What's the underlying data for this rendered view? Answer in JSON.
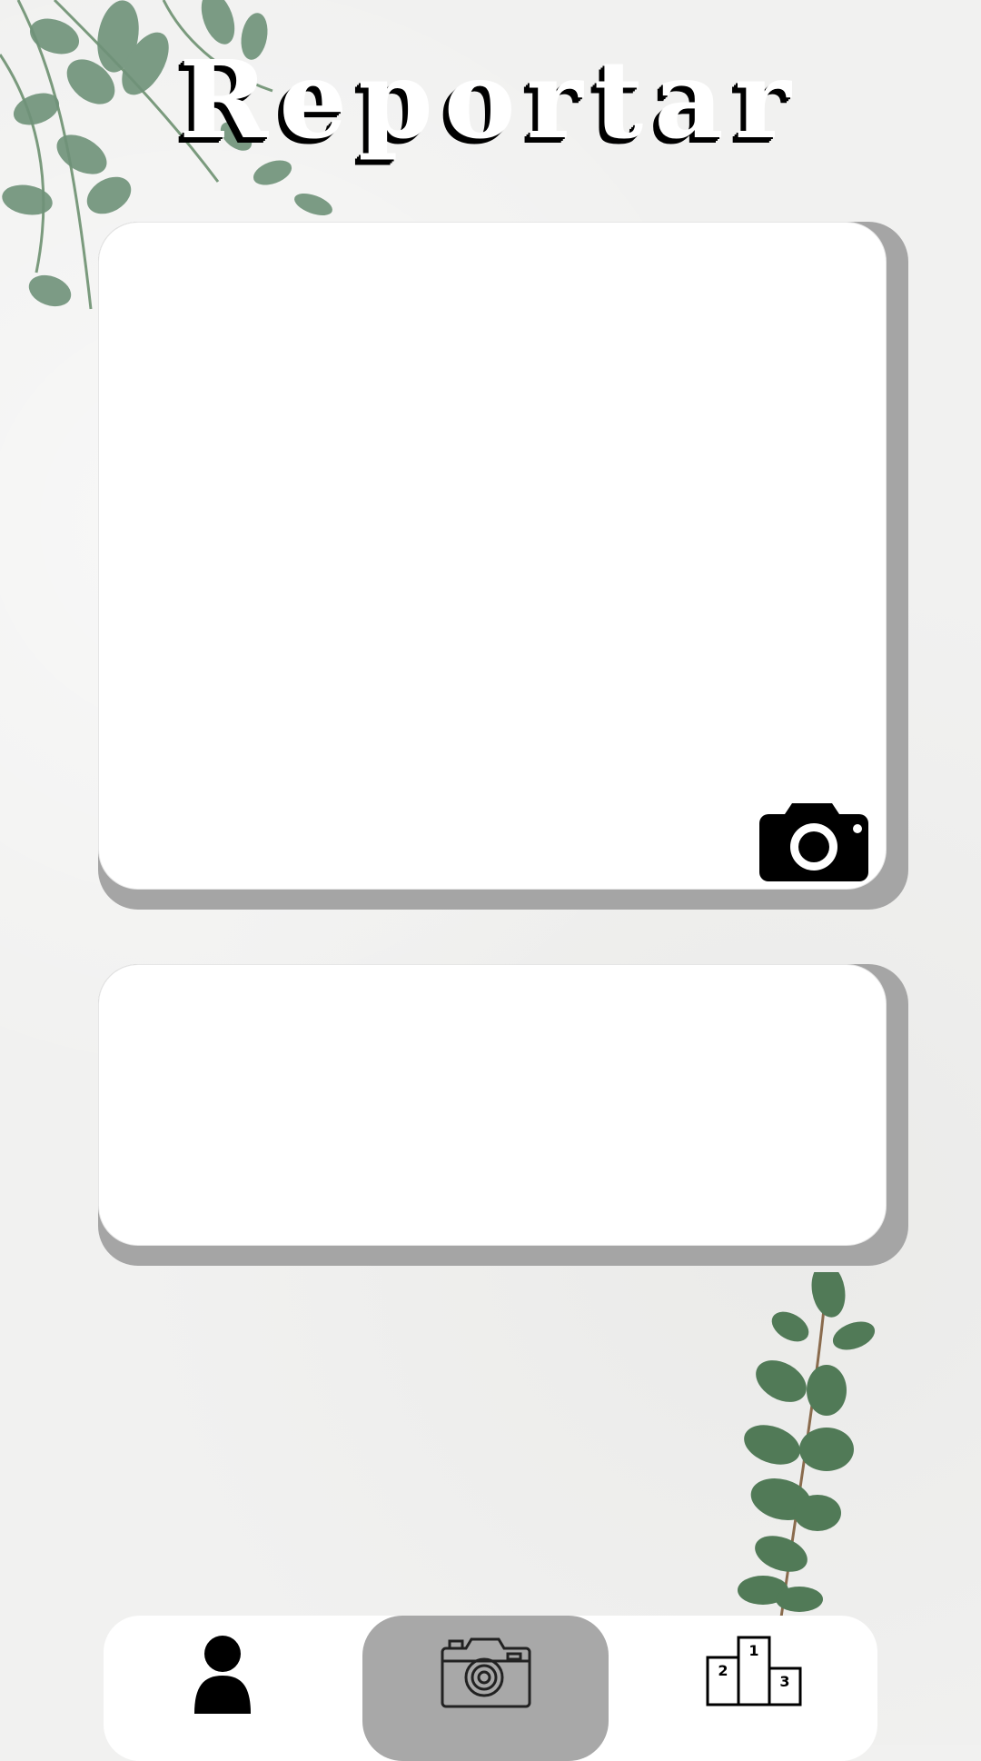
{
  "header": {
    "title": "Reportar"
  },
  "photo_card": {
    "camera_icon": "camera-icon"
  },
  "description_card": {},
  "navbar": {
    "items": [
      {
        "icon": "user-icon",
        "active": false
      },
      {
        "icon": "camera-outline-icon",
        "active": true
      },
      {
        "icon": "podium-icon",
        "active": false,
        "labels": [
          "1",
          "2",
          "3"
        ]
      }
    ]
  },
  "colors": {
    "background": "#f1f1f0",
    "card": "#ffffff",
    "card_shadow": "#a5a5a5",
    "nav_active": "#a8a8a8",
    "leaf": "#5f8a6f"
  }
}
